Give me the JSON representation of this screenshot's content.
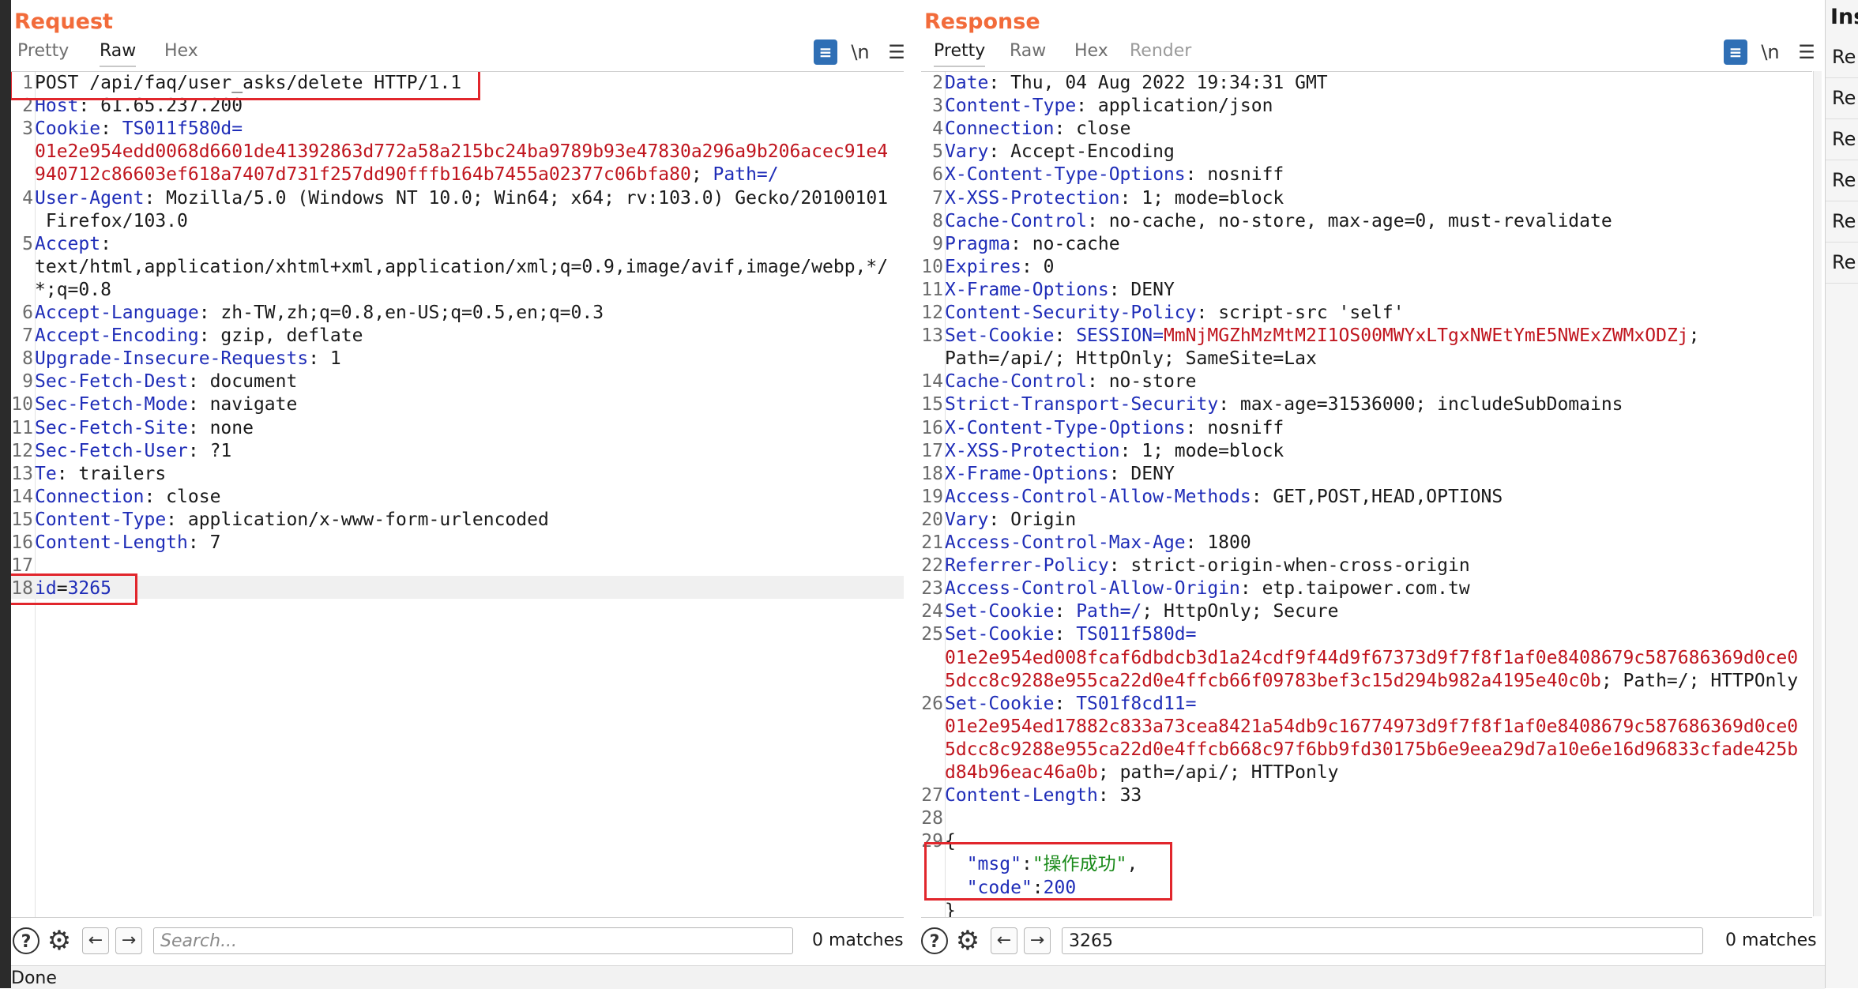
{
  "request": {
    "title": "Request",
    "tabs": [
      "Pretty",
      "Raw",
      "Hex"
    ],
    "active_tab": "Raw",
    "tools": {
      "format_icon": "format-icon",
      "newline_label": "\\n",
      "menu_icon": "menu-icon"
    },
    "lines": [
      {
        "n": "1",
        "parts": [
          {
            "t": "POST /api/faq/user_asks/delete HTTP/1.1",
            "c": "hv"
          }
        ]
      },
      {
        "n": "2",
        "parts": [
          {
            "t": "Host",
            "c": "hn"
          },
          {
            "t": ": 61.65.237.200",
            "c": "hv"
          }
        ]
      },
      {
        "n": "3",
        "parts": [
          {
            "t": "Cookie",
            "c": "hn"
          },
          {
            "t": ": ",
            "c": "hv"
          },
          {
            "t": "TS011f580d=",
            "c": "hn"
          }
        ]
      },
      {
        "n": "",
        "parts": [
          {
            "t": "01e2e954edd0068d6601de41392863d772a58a215bc24ba9789b93e47830a296a9b206acec91e4",
            "c": "ck"
          }
        ]
      },
      {
        "n": "",
        "parts": [
          {
            "t": "940712c86603ef618a7407d731f257dd90fffb164b7455a02377c06bfa80",
            "c": "ck"
          },
          {
            "t": "; ",
            "c": "hv"
          },
          {
            "t": "Path=/",
            "c": "hn"
          }
        ]
      },
      {
        "n": "4",
        "parts": [
          {
            "t": "User-Agent",
            "c": "hn"
          },
          {
            "t": ": Mozilla/5.0 (Windows NT 10.0; Win64; x64; rv:103.0) Gecko/20100101",
            "c": "hv"
          }
        ]
      },
      {
        "n": "",
        "parts": [
          {
            "t": " Firefox/103.0",
            "c": "hv"
          }
        ]
      },
      {
        "n": "5",
        "parts": [
          {
            "t": "Accept",
            "c": "hn"
          },
          {
            "t": ":",
            "c": "hv"
          }
        ]
      },
      {
        "n": "",
        "parts": [
          {
            "t": "text/html,application/xhtml+xml,application/xml;q=0.9,image/avif,image/webp,*/",
            "c": "hv"
          }
        ]
      },
      {
        "n": "",
        "parts": [
          {
            "t": "*;q=0.8",
            "c": "hv"
          }
        ]
      },
      {
        "n": "6",
        "parts": [
          {
            "t": "Accept-Language",
            "c": "hn"
          },
          {
            "t": ": zh-TW,zh;q=0.8,en-US;q=0.5,en;q=0.3",
            "c": "hv"
          }
        ]
      },
      {
        "n": "7",
        "parts": [
          {
            "t": "Accept-Encoding",
            "c": "hn"
          },
          {
            "t": ": gzip, deflate",
            "c": "hv"
          }
        ]
      },
      {
        "n": "8",
        "parts": [
          {
            "t": "Upgrade-Insecure-Requests",
            "c": "hn"
          },
          {
            "t": ": 1",
            "c": "hv"
          }
        ]
      },
      {
        "n": "9",
        "parts": [
          {
            "t": "Sec-Fetch-Dest",
            "c": "hn"
          },
          {
            "t": ": document",
            "c": "hv"
          }
        ]
      },
      {
        "n": "10",
        "parts": [
          {
            "t": "Sec-Fetch-Mode",
            "c": "hn"
          },
          {
            "t": ": navigate",
            "c": "hv"
          }
        ]
      },
      {
        "n": "11",
        "parts": [
          {
            "t": "Sec-Fetch-Site",
            "c": "hn"
          },
          {
            "t": ": none",
            "c": "hv"
          }
        ]
      },
      {
        "n": "12",
        "parts": [
          {
            "t": "Sec-Fetch-User",
            "c": "hn"
          },
          {
            "t": ": ?1",
            "c": "hv"
          }
        ]
      },
      {
        "n": "13",
        "parts": [
          {
            "t": "Te",
            "c": "hn"
          },
          {
            "t": ": trailers",
            "c": "hv"
          }
        ]
      },
      {
        "n": "14",
        "parts": [
          {
            "t": "Connection",
            "c": "hn"
          },
          {
            "t": ": close",
            "c": "hv"
          }
        ]
      },
      {
        "n": "15",
        "parts": [
          {
            "t": "Content-Type",
            "c": "hn"
          },
          {
            "t": ": application/x-www-form-urlencoded",
            "c": "hv"
          }
        ]
      },
      {
        "n": "16",
        "parts": [
          {
            "t": "Content-Length",
            "c": "hn"
          },
          {
            "t": ": 7",
            "c": "hv"
          }
        ]
      },
      {
        "n": "17",
        "parts": []
      },
      {
        "n": "18",
        "parts": [
          {
            "t": "id",
            "c": "hn"
          },
          {
            "t": "=",
            "c": "hv"
          },
          {
            "t": "3265",
            "c": "hn"
          }
        ]
      }
    ],
    "search": {
      "placeholder": "Search...",
      "value": "",
      "matches": "0 matches"
    }
  },
  "response": {
    "title": "Response",
    "tabs": [
      "Pretty",
      "Raw",
      "Hex",
      "Render"
    ],
    "active_tab": "Pretty",
    "tools": {
      "format_icon": "format-icon",
      "newline_label": "\\n",
      "menu_icon": "menu-icon"
    },
    "lines": [
      {
        "n": "2",
        "parts": [
          {
            "t": "Date",
            "c": "hn"
          },
          {
            "t": ": Thu, 04 Aug 2022 19:34:31 GMT",
            "c": "hv"
          }
        ]
      },
      {
        "n": "3",
        "parts": [
          {
            "t": "Content-Type",
            "c": "hn"
          },
          {
            "t": ": application/json",
            "c": "hv"
          }
        ]
      },
      {
        "n": "4",
        "parts": [
          {
            "t": "Connection",
            "c": "hn"
          },
          {
            "t": ": close",
            "c": "hv"
          }
        ]
      },
      {
        "n": "5",
        "parts": [
          {
            "t": "Vary",
            "c": "hn"
          },
          {
            "t": ": Accept-Encoding",
            "c": "hv"
          }
        ]
      },
      {
        "n": "6",
        "parts": [
          {
            "t": "X-Content-Type-Options",
            "c": "hn"
          },
          {
            "t": ": nosniff",
            "c": "hv"
          }
        ]
      },
      {
        "n": "7",
        "parts": [
          {
            "t": "X-XSS-Protection",
            "c": "hn"
          },
          {
            "t": ": 1; mode=block",
            "c": "hv"
          }
        ]
      },
      {
        "n": "8",
        "parts": [
          {
            "t": "Cache-Control",
            "c": "hn"
          },
          {
            "t": ": no-cache, no-store, max-age=0, must-revalidate",
            "c": "hv"
          }
        ]
      },
      {
        "n": "9",
        "parts": [
          {
            "t": "Pragma",
            "c": "hn"
          },
          {
            "t": ": no-cache",
            "c": "hv"
          }
        ]
      },
      {
        "n": "10",
        "parts": [
          {
            "t": "Expires",
            "c": "hn"
          },
          {
            "t": ": 0",
            "c": "hv"
          }
        ]
      },
      {
        "n": "11",
        "parts": [
          {
            "t": "X-Frame-Options",
            "c": "hn"
          },
          {
            "t": ": DENY",
            "c": "hv"
          }
        ]
      },
      {
        "n": "12",
        "parts": [
          {
            "t": "Content-Security-Policy",
            "c": "hn"
          },
          {
            "t": ": script-src 'self'",
            "c": "hv"
          }
        ]
      },
      {
        "n": "13",
        "parts": [
          {
            "t": "Set-Cookie",
            "c": "hn"
          },
          {
            "t": ": ",
            "c": "hv"
          },
          {
            "t": "SESSION=",
            "c": "hn"
          },
          {
            "t": "MmNjMGZhMzMtM2I1OS00MWYxLTgxNWEtYmE5NWExZWMxODZj",
            "c": "ck"
          },
          {
            "t": ";",
            "c": "hv"
          }
        ]
      },
      {
        "n": "",
        "parts": [
          {
            "t": "Path=/api/; HttpOnly; SameSite=Lax",
            "c": "hv"
          }
        ]
      },
      {
        "n": "14",
        "parts": [
          {
            "t": "Cache-Control",
            "c": "hn"
          },
          {
            "t": ": no-store",
            "c": "hv"
          }
        ]
      },
      {
        "n": "15",
        "parts": [
          {
            "t": "Strict-Transport-Security",
            "c": "hn"
          },
          {
            "t": ": max-age=31536000; includeSubDomains",
            "c": "hv"
          }
        ]
      },
      {
        "n": "16",
        "parts": [
          {
            "t": "X-Content-Type-Options",
            "c": "hn"
          },
          {
            "t": ": nosniff",
            "c": "hv"
          }
        ]
      },
      {
        "n": "17",
        "parts": [
          {
            "t": "X-XSS-Protection",
            "c": "hn"
          },
          {
            "t": ": 1; mode=block",
            "c": "hv"
          }
        ]
      },
      {
        "n": "18",
        "parts": [
          {
            "t": "X-Frame-Options",
            "c": "hn"
          },
          {
            "t": ": DENY",
            "c": "hv"
          }
        ]
      },
      {
        "n": "19",
        "parts": [
          {
            "t": "Access-Control-Allow-Methods",
            "c": "hn"
          },
          {
            "t": ": GET,POST,HEAD,OPTIONS",
            "c": "hv"
          }
        ]
      },
      {
        "n": "20",
        "parts": [
          {
            "t": "Vary",
            "c": "hn"
          },
          {
            "t": ": Origin",
            "c": "hv"
          }
        ]
      },
      {
        "n": "21",
        "parts": [
          {
            "t": "Access-Control-Max-Age",
            "c": "hn"
          },
          {
            "t": ": 1800",
            "c": "hv"
          }
        ]
      },
      {
        "n": "22",
        "parts": [
          {
            "t": "Referrer-Policy",
            "c": "hn"
          },
          {
            "t": ": strict-origin-when-cross-origin",
            "c": "hv"
          }
        ]
      },
      {
        "n": "23",
        "parts": [
          {
            "t": "Access-Control-Allow-Origin",
            "c": "hn"
          },
          {
            "t": ": etp.taipower.com.tw",
            "c": "hv"
          }
        ]
      },
      {
        "n": "24",
        "parts": [
          {
            "t": "Set-Cookie",
            "c": "hn"
          },
          {
            "t": ": ",
            "c": "hv"
          },
          {
            "t": "Path=/",
            "c": "hn"
          },
          {
            "t": "; HttpOnly; Secure",
            "c": "hv"
          }
        ]
      },
      {
        "n": "25",
        "parts": [
          {
            "t": "Set-Cookie",
            "c": "hn"
          },
          {
            "t": ": ",
            "c": "hv"
          },
          {
            "t": "TS011f580d=",
            "c": "hn"
          }
        ]
      },
      {
        "n": "",
        "parts": [
          {
            "t": "01e2e954ed008fcaf6dbdcb3d1a24cdf9f44d9f67373d9f7f8f1af0e8408679c587686369d0ce0",
            "c": "ck"
          }
        ]
      },
      {
        "n": "",
        "parts": [
          {
            "t": "5dcc8c9288e955ca22d0e4ffcb66f09783bef3c15d294b982a4195e40c0b",
            "c": "ck"
          },
          {
            "t": "; Path=/; HTTPOnly",
            "c": "hv"
          }
        ]
      },
      {
        "n": "26",
        "parts": [
          {
            "t": "Set-Cookie",
            "c": "hn"
          },
          {
            "t": ": ",
            "c": "hv"
          },
          {
            "t": "TS01f8cd11=",
            "c": "hn"
          }
        ]
      },
      {
        "n": "",
        "parts": [
          {
            "t": "01e2e954ed17882c833a73cea8421a54db9c16774973d9f7f8f1af0e8408679c587686369d0ce0",
            "c": "ck"
          }
        ]
      },
      {
        "n": "",
        "parts": [
          {
            "t": "5dcc8c9288e955ca22d0e4ffcb668c97f6bb9fd30175b6e9eea29d7a10e6e16d96833cfade425b",
            "c": "ck"
          }
        ]
      },
      {
        "n": "",
        "parts": [
          {
            "t": "d84b96eac46a0b",
            "c": "ck"
          },
          {
            "t": "; path=/api/; HTTPonly",
            "c": "hv"
          }
        ]
      },
      {
        "n": "27",
        "parts": [
          {
            "t": "Content-Length",
            "c": "hn"
          },
          {
            "t": ": 33",
            "c": "hv"
          }
        ]
      },
      {
        "n": "28",
        "parts": []
      },
      {
        "n": "29",
        "parts": [
          {
            "t": "{",
            "c": "hv"
          }
        ]
      },
      {
        "n": "",
        "parts": [
          {
            "t": "  ",
            "c": "hv"
          },
          {
            "t": "\"msg\"",
            "c": "jk"
          },
          {
            "t": ":",
            "c": "hv"
          },
          {
            "t": "\"操作成功\"",
            "c": "js"
          },
          {
            "t": ",",
            "c": "hv"
          }
        ]
      },
      {
        "n": "",
        "parts": [
          {
            "t": "  ",
            "c": "hv"
          },
          {
            "t": "\"code\"",
            "c": "jk"
          },
          {
            "t": ":",
            "c": "hv"
          },
          {
            "t": "200",
            "c": "jn"
          }
        ]
      },
      {
        "n": "",
        "parts": [
          {
            "t": "}",
            "c": "hv"
          }
        ]
      }
    ],
    "search": {
      "placeholder": "",
      "value": "3265",
      "matches": "0 matches"
    }
  },
  "inspector": {
    "title": "Ins",
    "rows": [
      "Re",
      "Re",
      "Re",
      "Re",
      "Re",
      "Re"
    ]
  },
  "status": {
    "text": "Done"
  },
  "colors": {
    "title": "#f26b3a",
    "header_name": "#1f2db8",
    "cookie_value": "#c0151e",
    "json_string": "#1a8a1a",
    "highlight_box": "#e1262c",
    "active_icon": "#2f6fb5"
  }
}
